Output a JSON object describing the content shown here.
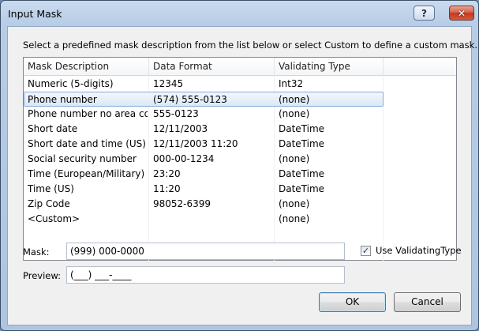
{
  "window": {
    "title": "Input Mask",
    "help_label": "?",
    "close_label": "✕"
  },
  "instructions": "Select a predefined mask description from the list below or select Custom to define a custom mask.",
  "list": {
    "columns": [
      "Mask Description",
      "Data Format",
      "Validating Type"
    ],
    "rows": [
      {
        "desc": "Numeric (5-digits)",
        "format": "12345",
        "type": "Int32"
      },
      {
        "desc": "Phone number",
        "format": "(574) 555-0123",
        "type": "(none)"
      },
      {
        "desc": "Phone number no area co...",
        "format": "555-0123",
        "type": "(none)"
      },
      {
        "desc": "Short date",
        "format": "12/11/2003",
        "type": "DateTime"
      },
      {
        "desc": "Short date and time (US)",
        "format": "12/11/2003 11:20",
        "type": "DateTime"
      },
      {
        "desc": "Social security number",
        "format": "000-00-1234",
        "type": "(none)"
      },
      {
        "desc": "Time (European/Military)",
        "format": "23:20",
        "type": "DateTime"
      },
      {
        "desc": "Time (US)",
        "format": "11:20",
        "type": "DateTime"
      },
      {
        "desc": "Zip Code",
        "format": "98052-6399",
        "type": "(none)"
      },
      {
        "desc": "<Custom>",
        "format": "",
        "type": "(none)"
      }
    ],
    "selected_row": "Phone number"
  },
  "mask": {
    "label": "Mask:",
    "value": "(999) 000-0000"
  },
  "preview": {
    "label": "Preview:",
    "value": "(___) ___-____"
  },
  "use_validating_type": {
    "label": "Use ValidatingType",
    "checked": true,
    "check_glyph": "✓"
  },
  "buttons": {
    "ok": "OK",
    "cancel": "Cancel"
  }
}
